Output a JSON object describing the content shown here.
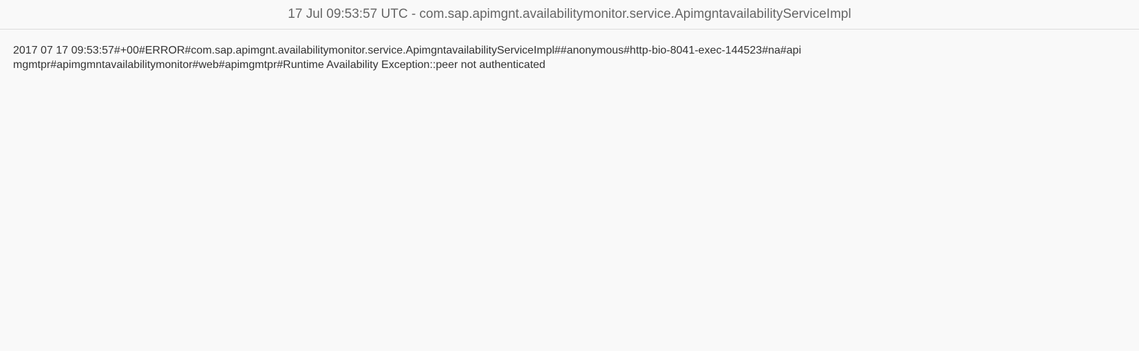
{
  "header": {
    "title": "17 Jul 09:53:57 UTC - com.sap.apimgnt.availabilitymonitor.service.ApimgntavailabilityServiceImpl"
  },
  "log": {
    "entry": "2017 07 17 09:53:57#+00#ERROR#com.sap.apimgnt.availabilitymonitor.service.ApimgntavailabilityServiceImpl##anonymous#http-bio-8041-exec-144523#na#apimgmtpr#apimgmntavailabilitymonitor#web#apimgmtpr#Runtime Availability Exception::peer not authenticated"
  },
  "colors": {
    "background": "#f9f9f9",
    "header_text": "#666666",
    "body_text": "#333333",
    "divider": "#dcdcdc"
  }
}
